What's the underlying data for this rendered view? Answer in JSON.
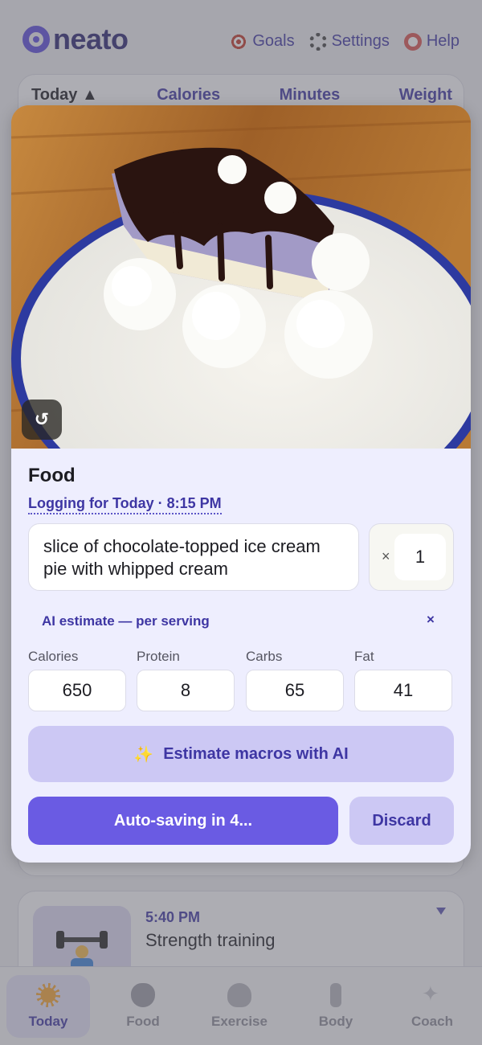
{
  "brand": {
    "name": "neato",
    "color": "#5b4bdb"
  },
  "top_nav": {
    "items": [
      {
        "label": "Goals",
        "icon": "target-icon"
      },
      {
        "label": "Settings",
        "icon": "gear-icon"
      },
      {
        "label": "Help",
        "icon": "lifebuoy-icon"
      }
    ]
  },
  "summary": {
    "tabs": [
      {
        "label": "Today ▲",
        "active": true
      },
      {
        "label": "Calories",
        "active": false
      },
      {
        "label": "Minutes",
        "active": false
      },
      {
        "label": "Weight",
        "active": false
      }
    ]
  },
  "entry": {
    "time": "5:40 PM",
    "title": "Strength training",
    "icon": "weightlifter-icon"
  },
  "bottom_nav": {
    "items": [
      {
        "label": "Today",
        "icon": "sun-icon",
        "active": true
      },
      {
        "label": "Food",
        "icon": "apple-icon",
        "active": false
      },
      {
        "label": "Exercise",
        "icon": "fire-icon",
        "active": false
      },
      {
        "label": "Body",
        "icon": "person-icon",
        "active": false
      },
      {
        "label": "Coach",
        "icon": "sparkles-icon",
        "active": false
      }
    ]
  },
  "food_modal": {
    "photo_subject": "slice of chocolate-topped ice cream pie with whipped cream on a blue-rimmed plate",
    "rotate_icon": "↺",
    "title": "Food",
    "logging_label": "Logging for Today · 8:15 PM",
    "description": "slice of chocolate-topped ice cream pie with whipped cream",
    "quantity_symbol": "×",
    "quantity": "1",
    "ai_note": "AI estimate — per serving",
    "ai_note_close": "×",
    "macros": [
      {
        "label": "Calories",
        "value": "650"
      },
      {
        "label": "Protein",
        "value": "8"
      },
      {
        "label": "Carbs",
        "value": "65"
      },
      {
        "label": "Fat",
        "value": "41"
      }
    ],
    "ai_button_icon": "✨",
    "ai_button_label": "Estimate macros with AI",
    "save_label": "Auto-saving in 4...",
    "discard_label": "Discard"
  },
  "colors": {
    "accent": "#6a5be3",
    "accent_soft": "#ccc8f4",
    "link": "#3e36a3",
    "modal_bg": "#eeeefe"
  }
}
